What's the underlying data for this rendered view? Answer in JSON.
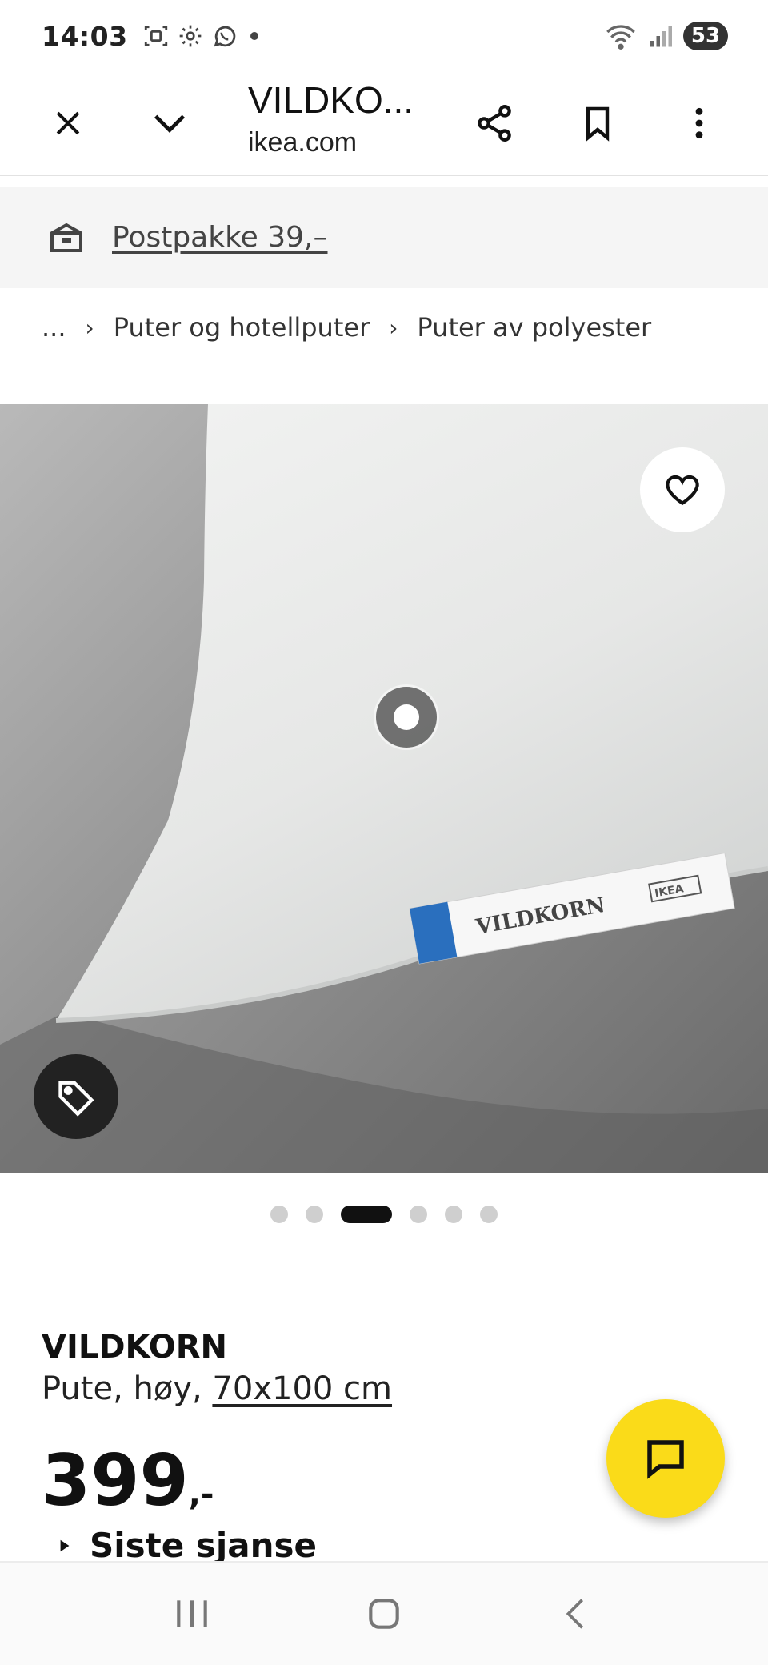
{
  "status_bar": {
    "time": "14:03",
    "battery": "53",
    "icons": [
      "screenshot-icon",
      "settings-icon",
      "whatsapp-icon",
      "dot-icon",
      "wifi-icon",
      "signal-icon"
    ]
  },
  "browser": {
    "title": "VILDKO...",
    "domain": "ikea.com"
  },
  "shipping": {
    "text": "Postpakke 39,–"
  },
  "breadcrumb": {
    "items": [
      "...",
      "Puter og hotellputer",
      "Puter av polyester"
    ]
  },
  "gallery": {
    "total_images": 6,
    "active_index": 2,
    "product_tag_text": "VILDKORN",
    "brand_tag_text": "IKEA"
  },
  "product": {
    "name": "VILDKORN",
    "desc_prefix": "Pute, høy, ",
    "size": "70x100 cm",
    "price": "399",
    "price_suffix": ",-",
    "sale_label": "Siste sjanse"
  },
  "colors": {
    "accent_yellow": "#fadb19",
    "primary_dark": "#111111",
    "strip_bg": "#f5f5f5"
  }
}
